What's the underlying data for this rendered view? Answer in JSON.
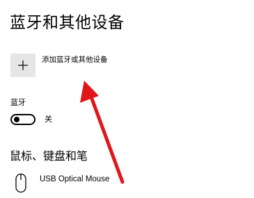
{
  "page": {
    "title": "蓝牙和其他设备"
  },
  "add_device": {
    "icon": "plus-icon",
    "label": "添加蓝牙或其他设备"
  },
  "bluetooth": {
    "label": "蓝牙",
    "toggle_state_text": "关",
    "is_on": false
  },
  "mouse_section": {
    "title": "鼠标、键盘和笔",
    "devices": [
      {
        "icon": "mouse-icon",
        "name": "USB Optical Mouse"
      }
    ]
  },
  "annotation": {
    "arrow_color": "#e0161b"
  }
}
